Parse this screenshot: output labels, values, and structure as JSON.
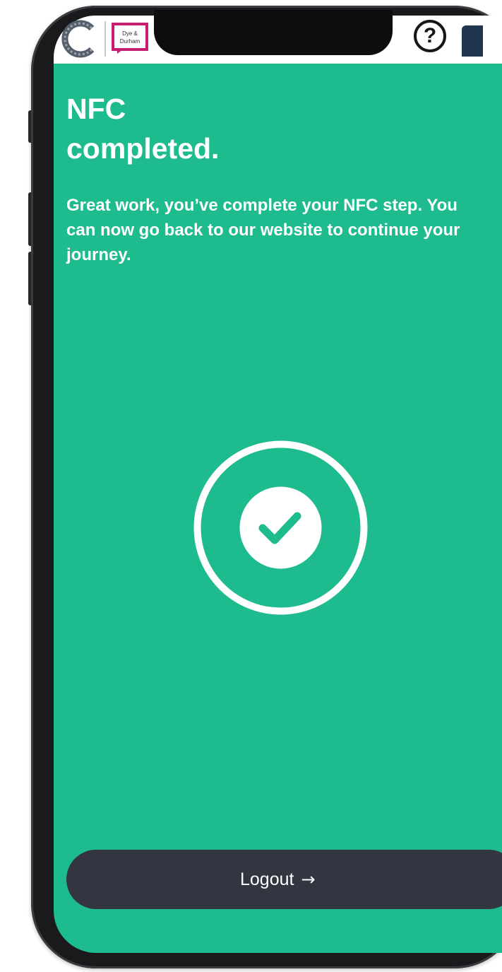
{
  "header": {
    "partner_logo_text": "Dye & Durham",
    "help_glyph": "?"
  },
  "main": {
    "title_line1": "NFC",
    "title_line2": "completed.",
    "description": "Great work, you’ve complete your NFC step. You can now go back to our website to continue your journey.",
    "status_icon": "check-circle-icon"
  },
  "footer": {
    "logout_label": "Logout",
    "logout_arrow": "→"
  },
  "colors": {
    "screen_background": "#1dbb8e",
    "button_background": "#333541",
    "text": "#ffffff",
    "partner_brand": "#c41e6e"
  }
}
